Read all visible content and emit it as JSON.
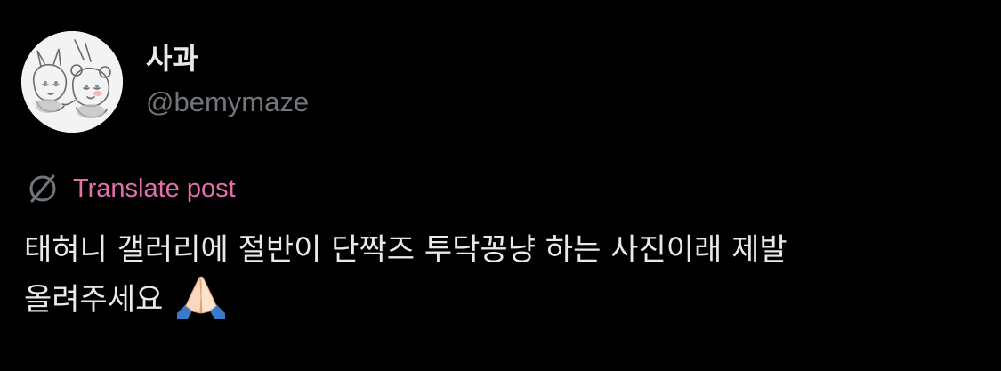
{
  "author": {
    "display_name": "사과",
    "handle": "@bemymaze"
  },
  "translate": {
    "label": "Translate post",
    "icon": "translate-globe-icon",
    "color": "#e36fa6"
  },
  "post": {
    "line1": "태혀니 갤러리에 절반이 단짝즈 투닥꽁냥 하는 사진이래 제발",
    "line2": "올려주세요",
    "emoji": "folded-hands-emoji"
  },
  "colors": {
    "background": "#000000",
    "primary_text": "#e7e9ea",
    "secondary_text": "#71767b"
  }
}
